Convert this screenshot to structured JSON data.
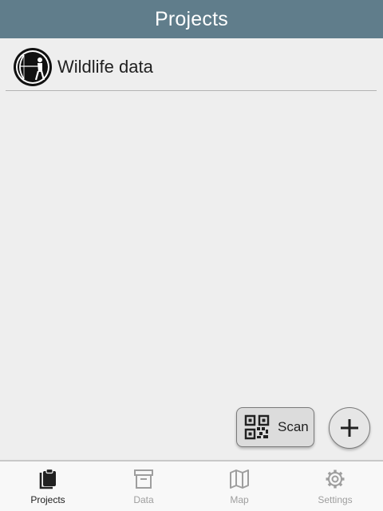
{
  "colors": {
    "header_bg": "#607d8b",
    "active_nav": "#212121",
    "inactive_nav": "#9e9e9e"
  },
  "header": {
    "title": "Projects"
  },
  "projects": [
    {
      "name": "Wildlife data",
      "icon": "archer-logo-icon"
    }
  ],
  "actions": {
    "scan": {
      "label": "Scan",
      "icon": "qr-code-icon"
    },
    "add": {
      "icon": "plus-icon"
    }
  },
  "bottom_nav": {
    "items": [
      {
        "label": "Projects",
        "icon": "clipboard-icon",
        "active": true
      },
      {
        "label": "Data",
        "icon": "archive-box-icon",
        "active": false
      },
      {
        "label": "Map",
        "icon": "map-icon",
        "active": false
      },
      {
        "label": "Settings",
        "icon": "gear-icon",
        "active": false
      }
    ]
  }
}
